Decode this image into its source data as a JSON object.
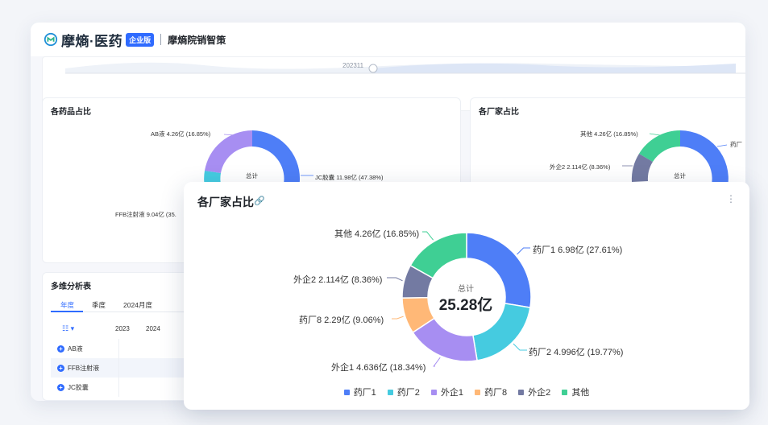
{
  "header": {
    "brand": "摩熵·医药",
    "badge": "企业版",
    "product": "摩熵院销智策"
  },
  "timeline": {
    "label": "202311"
  },
  "drug_share_card": {
    "title": "各药品占比",
    "labels": {
      "ab": "AB液 4.26亿 (16.85%)",
      "jc": "JC胶囊 11.98亿 (47.38%)",
      "ffb": "FFB注射液 9.04亿 (35."
    },
    "center": "总计"
  },
  "maker_share_card": {
    "title": "各厂家占比",
    "labels": {
      "other": "其他 4.26亿 (16.85%)",
      "wq2": "外企2 2.114亿 (8.36%)",
      "yc": "药厂"
    },
    "center": "总计"
  },
  "analysis": {
    "title": "多维分析表",
    "tabs": [
      "年度",
      "季度",
      "2024月度"
    ],
    "header_icon": "table-settings-icon",
    "years": [
      "2023",
      "2024"
    ],
    "rows": [
      "AB液",
      "FFB注射液",
      "JC胶囊"
    ]
  },
  "popup": {
    "title": "各厂家占比",
    "center_label": "总计",
    "center_value": "25.28亿",
    "labels": {
      "yc1": "药厂1 6.98亿 (27.61%)",
      "yc2": "药厂2 4.996亿 (19.77%)",
      "wq1": "外企1 4.636亿 (18.34%)",
      "yc8": "药厂8 2.29亿 (9.06%)",
      "wq2": "外企2 2.114亿 (8.36%)",
      "other": "其他 4.26亿 (16.85%)"
    },
    "legend": [
      "药厂1",
      "药厂2",
      "外企1",
      "药厂8",
      "外企2",
      "其他"
    ]
  },
  "chart_data": [
    {
      "type": "pie",
      "title": "各厂家占比",
      "categories": [
        "药厂1",
        "药厂2",
        "外企1",
        "药厂8",
        "外企2",
        "其他"
      ],
      "values": [
        6.98,
        4.996,
        4.636,
        2.29,
        2.114,
        4.26
      ],
      "percent": [
        27.61,
        19.77,
        18.34,
        9.06,
        8.36,
        16.85
      ],
      "colors": [
        "#4e7ef7",
        "#45cbe0",
        "#a78ef2",
        "#ffb877",
        "#737aa2",
        "#3fcf94"
      ],
      "total": "25.28亿",
      "legend": "bottom"
    },
    {
      "type": "pie",
      "title": "各药品占比",
      "categories": [
        "JC胶囊",
        "FFB注射液",
        "AB液"
      ],
      "values": [
        11.98,
        9.04,
        4.26
      ],
      "percent": [
        47.38,
        35.77,
        16.85
      ],
      "colors": [
        "#4e7ef7",
        "#45cbe0",
        "#a78ef2"
      ]
    }
  ]
}
